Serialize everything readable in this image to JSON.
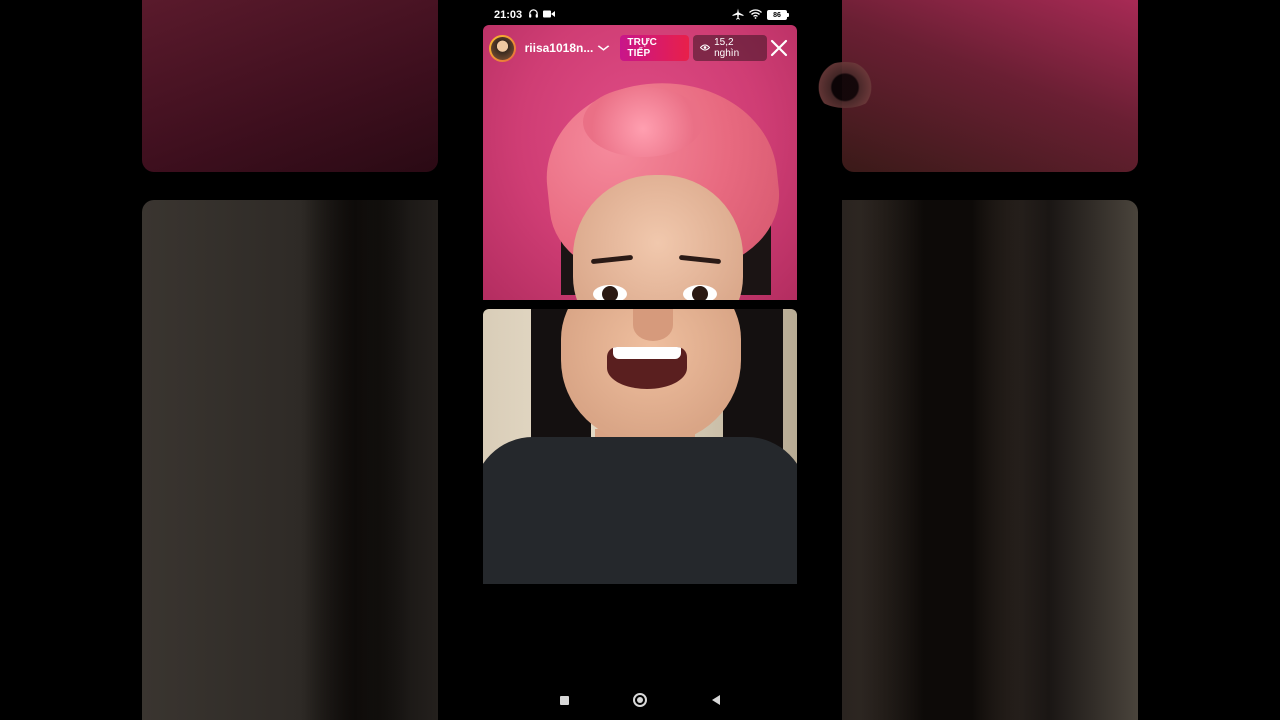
{
  "status_bar": {
    "time": "21:03",
    "battery": "86",
    "icons": [
      "headphones-icon",
      "video-camera-icon",
      "airplane-mode-icon",
      "wifi-icon",
      "battery-icon"
    ]
  },
  "live": {
    "username": "riisa1018n...",
    "live_label": "TRỰC TIẾP",
    "viewer_count": "15,2 nghìn"
  },
  "colors": {
    "live_badge_start": "#c8158a",
    "live_badge_end": "#e8204a",
    "avatar_ring": "#f9c12e"
  },
  "nav_bar": {
    "buttons": [
      "recents-button",
      "home-button",
      "back-button"
    ]
  }
}
